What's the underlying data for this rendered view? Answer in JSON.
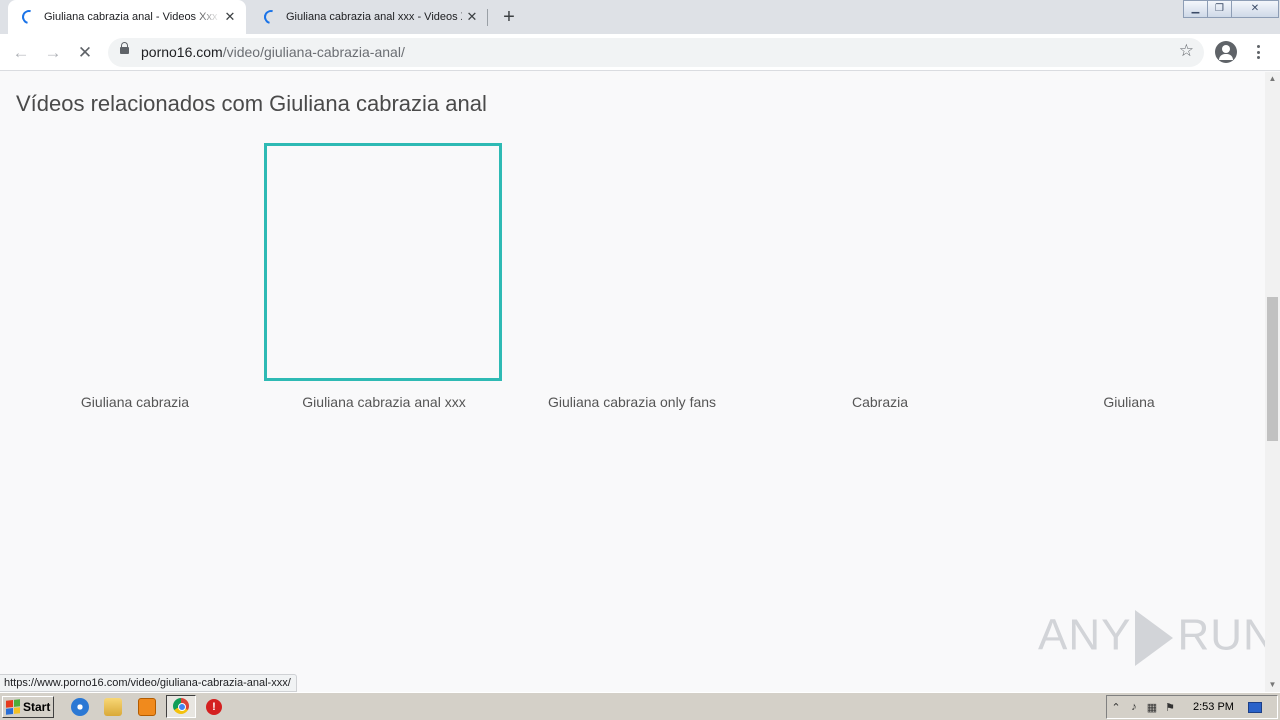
{
  "browser": {
    "tabs": [
      {
        "title": "Giuliana cabrazia anal - Videos Xxx | Pornô",
        "active": true
      },
      {
        "title": "Giuliana cabrazia anal xxx - Videos Xxx | Pornô",
        "active": false
      }
    ],
    "new_tab_label": "+",
    "window_controls": {
      "minimize": "▁",
      "restore": "❐",
      "close": "✕"
    },
    "nav": {
      "back_icon": "←",
      "forward_icon": "→",
      "stop_icon": "✕"
    },
    "url_domain": "porno16.com",
    "url_path": "/video/giuliana-cabrazia-anal/",
    "bookmark_icon": "☆",
    "status_url": "https://www.porno16.com/video/giuliana-cabrazia-anal-xxx/"
  },
  "page": {
    "heading": "Vídeos relacionados com Giuliana cabrazia anal",
    "videos": [
      {
        "label": "Giuliana cabrazia"
      },
      {
        "label": "Giuliana cabrazia anal xxx"
      },
      {
        "label": "Giuliana cabrazia only fans"
      },
      {
        "label": "Cabrazia"
      },
      {
        "label": "Giuliana"
      }
    ],
    "accent_color": "#2ebab4"
  },
  "watermark": {
    "left": "ANY",
    "right": "RUN"
  },
  "taskbar": {
    "start_label": "Start",
    "clock": "2:53 PM"
  }
}
